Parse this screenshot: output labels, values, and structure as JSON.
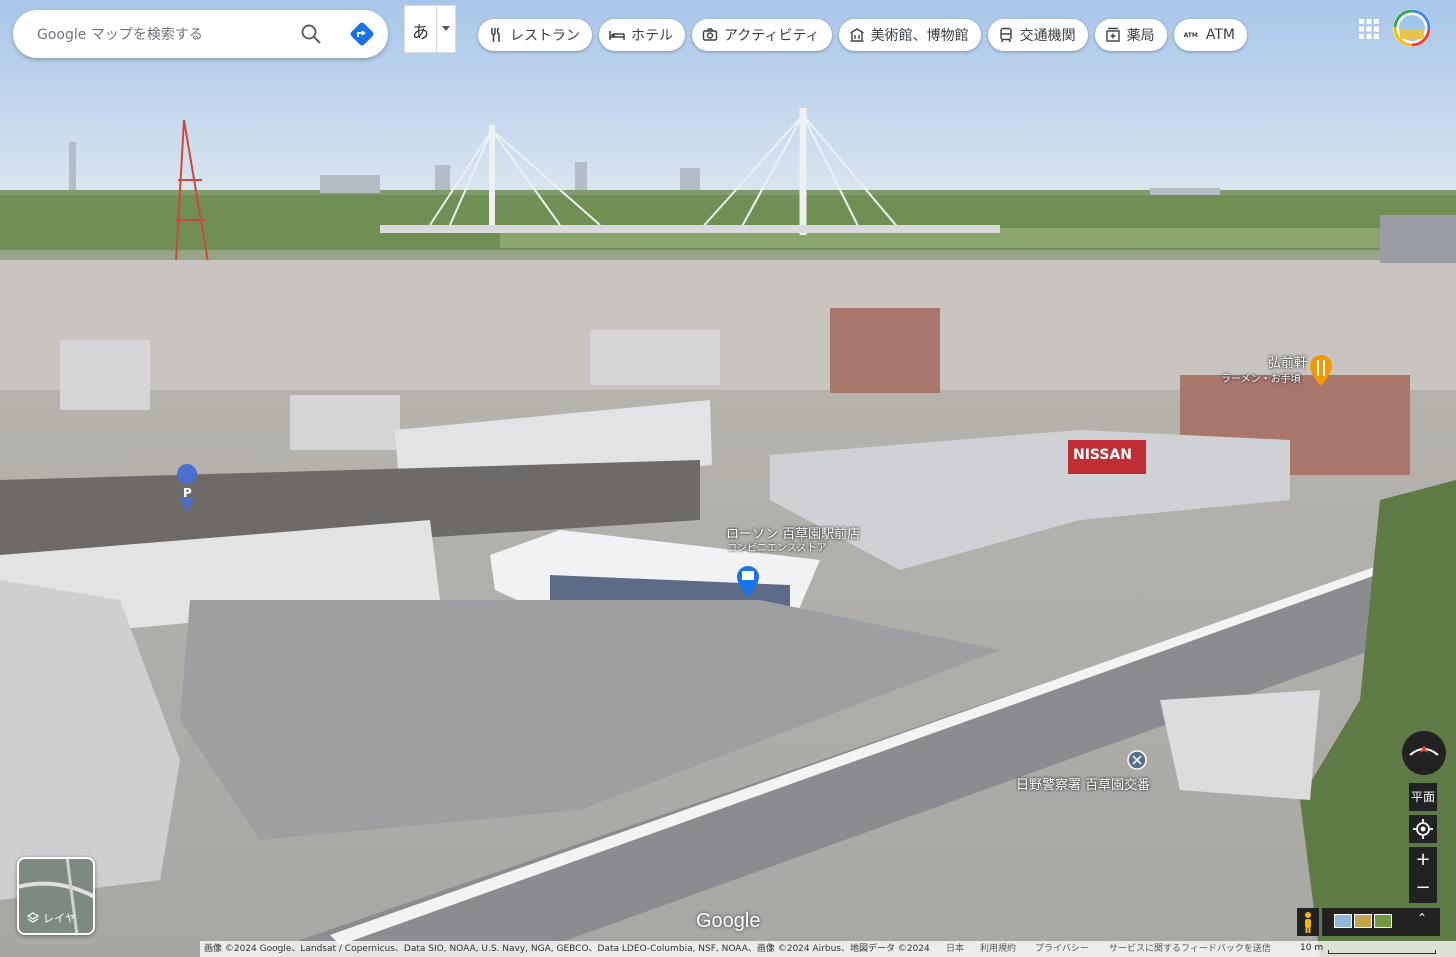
{
  "search": {
    "placeholder": "Google マップを検索する"
  },
  "ime": {
    "char": "あ"
  },
  "chips": [
    {
      "label": "レストラン",
      "icon": "fork-knife-icon"
    },
    {
      "label": "ホテル",
      "icon": "bed-icon"
    },
    {
      "label": "アクティビティ",
      "icon": "camera-icon"
    },
    {
      "label": "美術館、博物館",
      "icon": "museum-icon"
    },
    {
      "label": "交通機関",
      "icon": "train-icon"
    },
    {
      "label": "薬局",
      "icon": "pharmacy-icon"
    },
    {
      "label": "ATM",
      "icon": "atm-icon",
      "symbol": "ATM"
    }
  ],
  "places": {
    "lawson": {
      "name": "ローソン 百草園駅前店",
      "category": "コンビニエンスストア"
    },
    "ramen": {
      "name": "弘前軒",
      "category": "ラーメン・お手頃"
    },
    "police": {
      "name": "日野警察署 百草園交番"
    },
    "parking": {
      "symbol": "P"
    },
    "nissan_sign": "NISSAN"
  },
  "layers": {
    "label": "レイヤ"
  },
  "controls": {
    "tilt_label": "平面",
    "zoom_in": "+",
    "zoom_out": "−"
  },
  "logo": "Google",
  "footer": {
    "attribution": "画像 ©2024 Google、Landsat / Copernicus、Data SIO, NOAA, U.S. Navy, NGA, GEBCO、Data LDEO-Columbia, NSF, NOAA、画像 ©2024 Airbus、地図データ ©2024",
    "country": "日本",
    "terms": "利用規約",
    "privacy": "プライバシー",
    "feedback": "サービスに関するフィードバックを送信",
    "scale": "10 m"
  },
  "colors": {
    "pin_red": "#ea4335",
    "pin_blue": "#1a73e8",
    "ramen_pin": "#f29900",
    "sky": "#9dbde3"
  }
}
